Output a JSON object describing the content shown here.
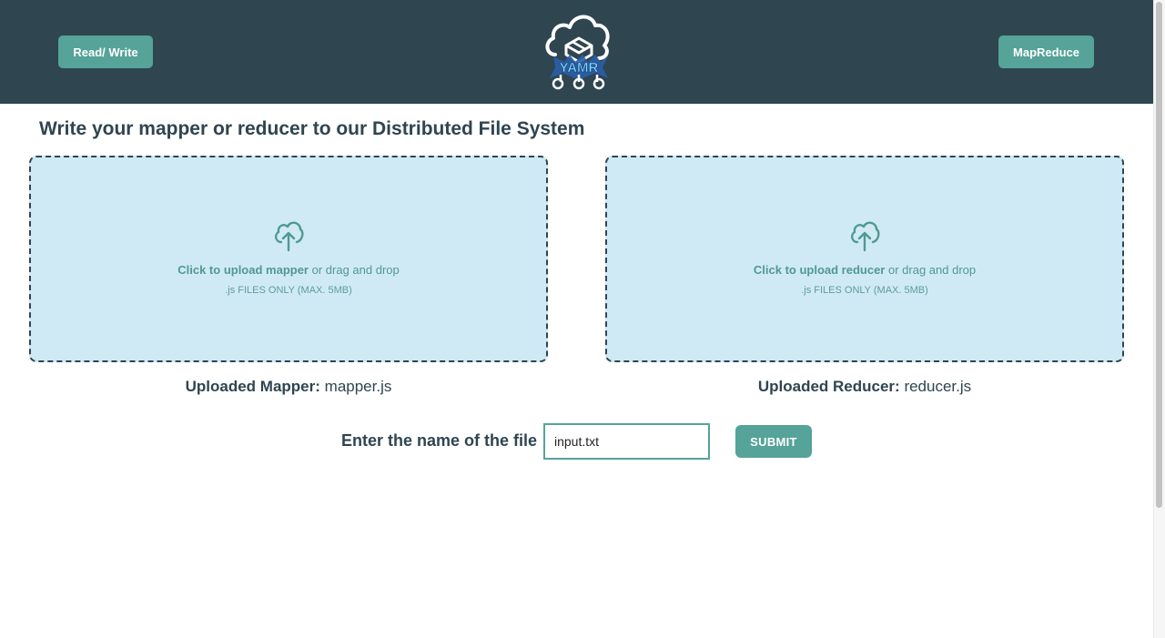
{
  "header": {
    "left_button": "Read/ Write",
    "right_button": "MapReduce",
    "logo_text": "YAMR",
    "background_color": "#2f4550",
    "button_color": "#55a399"
  },
  "main": {
    "title": "Write your mapper or reducer to our Distributed File System",
    "mapper_upload": {
      "icon": "cloud-upload-icon",
      "link_text": "Click to upload mapper",
      "rest_text": " or drag and drop",
      "hint": ".js FILES ONLY (MAX. 5MB)"
    },
    "reducer_upload": {
      "icon": "cloud-upload-icon",
      "link_text": "Click to upload reducer",
      "rest_text": " or drag and drop",
      "hint": ".js FILES ONLY (MAX. 5MB)"
    },
    "uploaded_mapper_label": "Uploaded Mapper:",
    "uploaded_mapper_value": "mapper.js",
    "uploaded_reducer_label": "Uploaded Reducer:",
    "uploaded_reducer_value": "reducer.js",
    "file_name_label": "Enter the name of the file",
    "file_name_value": "input.txt",
    "submit_label": "SUBMIT",
    "dropzone_color": "#d0eaf5"
  }
}
